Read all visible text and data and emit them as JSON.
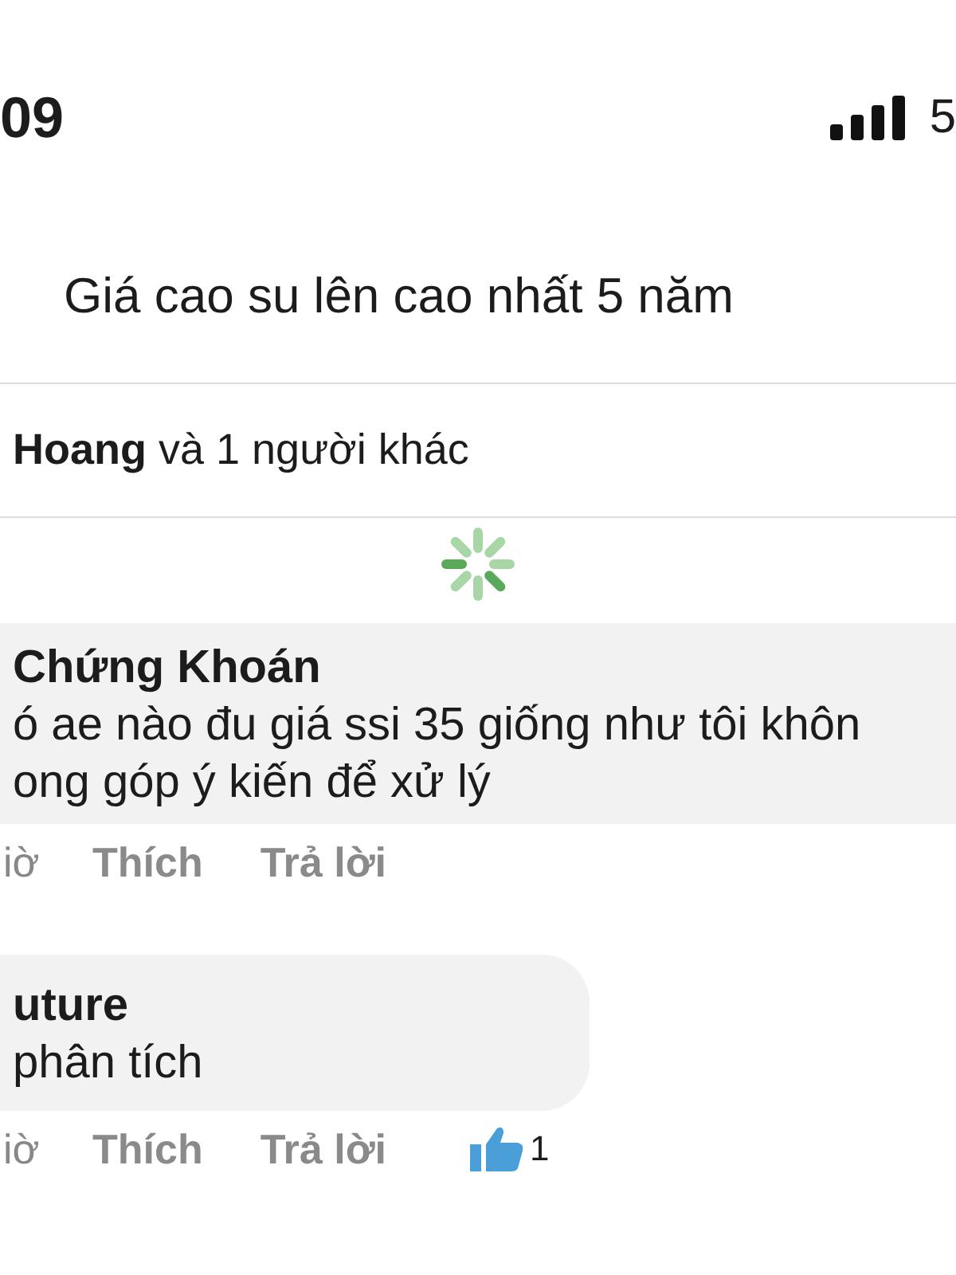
{
  "status_bar": {
    "time": "09",
    "network": "5"
  },
  "post": {
    "title": "Giá cao su lên cao nhất 5 năm"
  },
  "reactions": {
    "name": "Hoang",
    "rest": "và 1 người khác"
  },
  "comments": [
    {
      "author": "Chứng Khoán",
      "text": "ó ae nào đu giá ssi 35 giống như tôi khôn",
      "text_2": "ong góp ý kiến để xử lý",
      "time": "iờ",
      "like": "Thích",
      "reply": "Trả lời",
      "full_width": true
    },
    {
      "author": "uture",
      "text": "phân tích",
      "time": "iờ",
      "like": "Thích",
      "reply": "Trả lời",
      "full_width": false,
      "like_count": "1"
    }
  ]
}
